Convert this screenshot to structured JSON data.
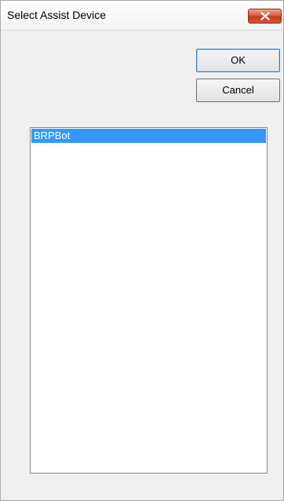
{
  "window": {
    "title": "Select Assist Device"
  },
  "buttons": {
    "ok_label": "OK",
    "cancel_label": "Cancel"
  },
  "device_list": {
    "items": [
      {
        "label": "BRPBot",
        "selected": true
      }
    ]
  },
  "icons": {
    "close": "close-icon"
  },
  "colors": {
    "selection": "#3399ff",
    "close_button": "#c7361c"
  }
}
